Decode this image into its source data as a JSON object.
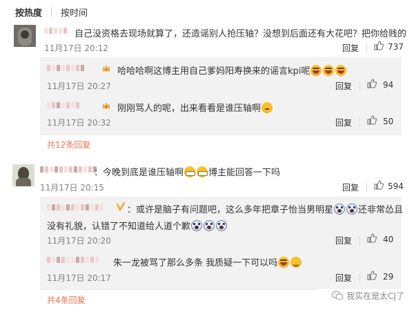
{
  "tabs": {
    "hot": "按热度",
    "time": "按时间"
  },
  "comments": [
    {
      "text": "自己没资格去现场就算了，还造谣别人抢压轴？没想到后面还有大花吧？把你给贱的",
      "time": "11月17日 20:12",
      "reply_label": "回复",
      "likes": "737",
      "replies": [
        {
          "text": "哈哈哈啊这博主用自己爹妈阳寿换来的谣言kpi呢",
          "emojis": [
            "laugh",
            "laugh",
            "laugh"
          ],
          "time": "11月17日 20:27",
          "reply_label": "回复",
          "likes": "94"
        },
        {
          "text": "刚刚骂人的呢，出来看看是谁压轴啊",
          "emojis": [
            "think"
          ],
          "time": "11月17日 20:32",
          "reply_label": "回复",
          "likes": "50"
        }
      ],
      "more": "共12条回复"
    },
    {
      "text_before": "：今晚到底是谁压轴啊",
      "text_after": "博主能回答一下吗",
      "emojis": [
        "grin",
        "grin"
      ],
      "time": "11月17日 20:15",
      "reply_label": "回复",
      "likes": "594",
      "replies": [
        {
          "line1": "：或许是脑子有问题吧，这么多年把章子怡当男明星",
          "line1_after": "还非常怂且",
          "line2": "没有礼貌，认错了不知道给人道个歉",
          "emojis1": [
            "shock",
            "shock"
          ],
          "emojis2": [
            "shock",
            "shock",
            "shock"
          ],
          "time": "11月17日 20:20",
          "reply_label": "回复",
          "likes": "40"
        },
        {
          "text": "朱一龙被骂了那么多条 我质疑一下可以吗",
          "emojis": [
            "laugh",
            "smile"
          ],
          "time": "11月17日 20:17",
          "reply_label": "回复",
          "likes": "29"
        }
      ],
      "more": "共4条回复"
    }
  ],
  "watermark": "我实在是太CJ了",
  "icons": {
    "like": "thumb-up-icon",
    "wechat": "wechat-icon",
    "vip": "crown-icon"
  },
  "colors": {
    "more_link": "#eb7350",
    "sub_bg": "#f2f2f2",
    "muted": "#808080"
  }
}
